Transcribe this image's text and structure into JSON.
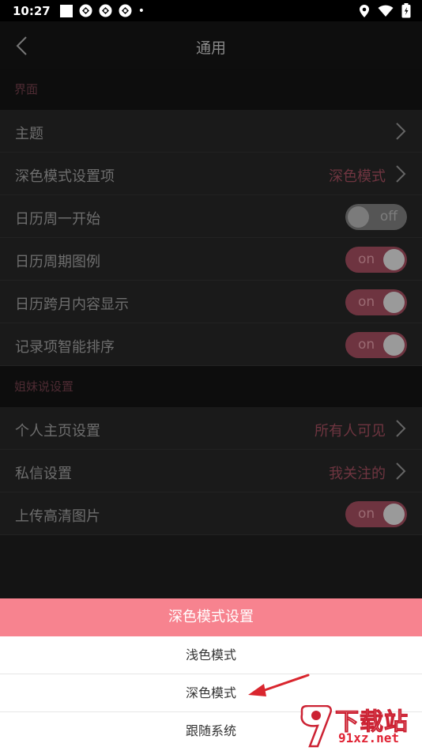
{
  "status_bar": {
    "time": "10:27",
    "dot": "•"
  },
  "header": {
    "title": "通用"
  },
  "sections": {
    "ui": {
      "title": "界面",
      "theme_label": "主题",
      "dark_mode_label": "深色模式设置项",
      "dark_mode_value": "深色模式",
      "calendar_week_label": "日历周一开始",
      "calendar_week_state": "off",
      "calendar_legend_label": "日历周期图例",
      "calendar_legend_state": "on",
      "calendar_cross_label": "日历跨月内容显示",
      "calendar_cross_state": "on",
      "smart_sort_label": "记录项智能排序",
      "smart_sort_state": "on"
    },
    "sisters": {
      "title": "姐妹说设置",
      "profile_label": "个人主页设置",
      "profile_value": "所有人可见",
      "dm_label": "私信设置",
      "dm_value": "我关注的",
      "hd_upload_label": "上传高清图片",
      "hd_upload_state": "on"
    }
  },
  "sheet": {
    "title": "深色模式设置",
    "options": [
      "浅色模式",
      "深色模式",
      "跟随系统"
    ]
  },
  "watermark": {
    "title": "下载站",
    "url": "91xz.net"
  },
  "colors": {
    "accent": "#f7838f",
    "dim_accent": "#6f3540"
  }
}
